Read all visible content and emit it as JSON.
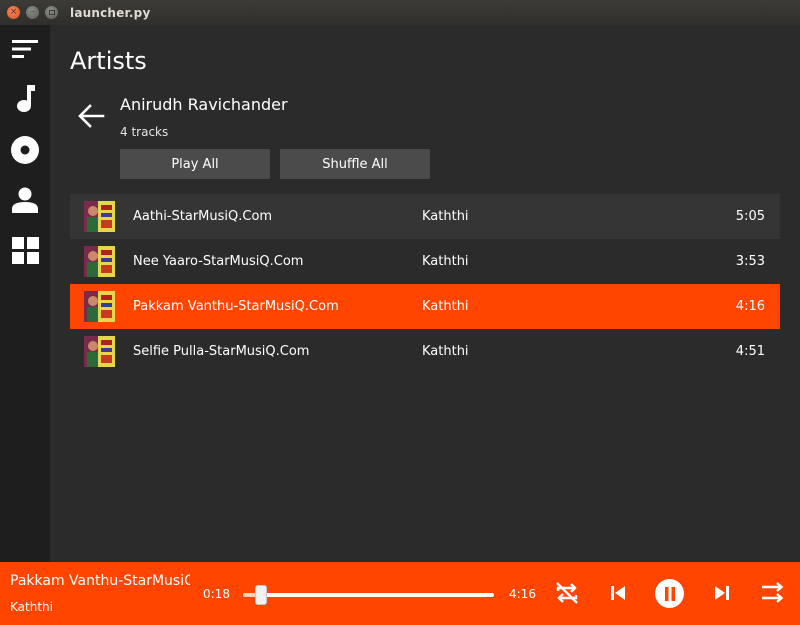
{
  "window": {
    "title": "launcher.py"
  },
  "sidebar": {
    "items": [
      {
        "icon": "menu-icon"
      },
      {
        "icon": "music-note-icon"
      },
      {
        "icon": "disc-icon"
      },
      {
        "icon": "person-icon"
      },
      {
        "icon": "grid-icon"
      }
    ]
  },
  "main": {
    "title": "Artists",
    "artist": {
      "name": "Anirudh Ravichander",
      "track_count": "4 tracks"
    },
    "buttons": {
      "play_all": "Play All",
      "shuffle_all": "Shuffle All"
    },
    "tracks": [
      {
        "name": "Aathi-StarMusiQ.Com",
        "album": "Kaththi",
        "duration": "5:05"
      },
      {
        "name": "Nee Yaaro-StarMusiQ.Com",
        "album": "Kaththi",
        "duration": "3:53"
      },
      {
        "name": "Pakkam Vanthu-StarMusiQ.Com",
        "album": "Kaththi",
        "duration": "4:16"
      },
      {
        "name": "Selfie Pulla-StarMusiQ.Com",
        "album": "Kaththi",
        "duration": "4:51"
      }
    ],
    "active_track_index": 2
  },
  "player": {
    "now_playing_title": "Pakkam Vanthu-StarMusiQ.Com",
    "now_playing_artist": "Kaththi",
    "current_time": "0:18",
    "total_time": "4:16",
    "progress": 0.07
  },
  "colors": {
    "accent": "#ff4500",
    "sidebar_bg": "#1e1e1e",
    "main_bg": "#2b2b2b",
    "row_alt_bg": "#353535",
    "button_bg": "#4b4b4b"
  }
}
